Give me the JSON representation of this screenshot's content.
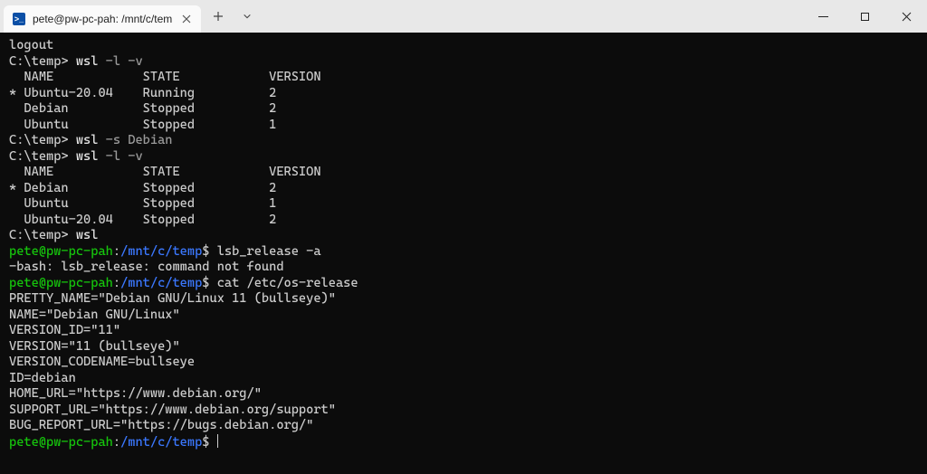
{
  "titlebar": {
    "tab_label": "pete@pw-pc-pah: /mnt/c/tem",
    "tab_icon_glyph": ">_"
  },
  "term": {
    "line_logout": "logout",
    "cmd_prompt_win": "C:\\temp>",
    "cmd_wsl_lv": "wsl",
    "cmd_wsl_lv_args": " -l -v",
    "hdr_name": "  NAME",
    "hdr_state": "STATE",
    "hdr_version": "VERSION",
    "lv1_r1_name": "* Ubuntu-20.04",
    "lv1_r1_state": "Running",
    "lv1_r1_ver": "2",
    "lv1_r2_name": "  Debian",
    "lv1_r2_state": "Stopped",
    "lv1_r2_ver": "2",
    "lv1_r3_name": "  Ubuntu",
    "lv1_r3_state": "Stopped",
    "lv1_r3_ver": "1",
    "cmd_wsl_s": "wsl",
    "cmd_wsl_s_args": " -s Debian",
    "cmd_wsl_lv2": "wsl",
    "cmd_wsl_lv2_args": " -l -v",
    "lv2_r1_name": "* Debian",
    "lv2_r1_state": "Stopped",
    "lv2_r1_ver": "2",
    "lv2_r2_name": "  Ubuntu",
    "lv2_r2_state": "Stopped",
    "lv2_r2_ver": "1",
    "lv2_r3_name": "  Ubuntu-20.04",
    "lv2_r3_state": "Stopped",
    "lv2_r3_ver": "2",
    "cmd_wsl_plain": "wsl",
    "bash_user": "pete@pw-pc-pah",
    "bash_colon": ":",
    "bash_path": "/mnt/c/temp",
    "bash_dollar": "$",
    "cmd_lsb": " lsb_release -a",
    "lsb_err": "-bash: lsb_release: command not found",
    "cmd_cat": " cat /etc/os-release",
    "os1": "PRETTY_NAME=\"Debian GNU/Linux 11 (bullseye)\"",
    "os2": "NAME=\"Debian GNU/Linux\"",
    "os3": "VERSION_ID=\"11\"",
    "os4": "VERSION=\"11 (bullseye)\"",
    "os5": "VERSION_CODENAME=bullseye",
    "os6": "ID=debian",
    "os7": "HOME_URL=\"https://www.debian.org/\"",
    "os8": "SUPPORT_URL=\"https://www.debian.org/support\"",
    "os9": "BUG_REPORT_URL=\"https://bugs.debian.org/\""
  },
  "cols": {
    "name_w": 18,
    "state_w": 17
  }
}
